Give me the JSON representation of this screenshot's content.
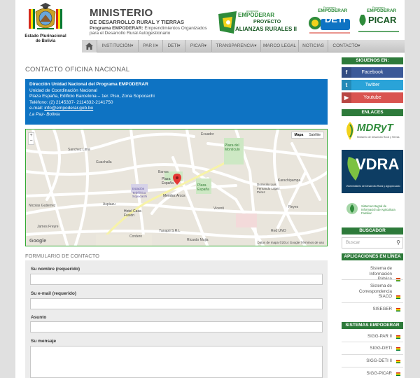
{
  "header": {
    "crest_text_1": "Estado Plurinacional",
    "crest_text_2": "de Bolivia",
    "ministry_title": "MINISTERIO",
    "ministry_subtitle": "DE DESARROLLO RURAL Y TIERRAS",
    "program_bold": "Programa EMPODERAR:",
    "program_desc_1": "Emprendimientos Organizados",
    "program_desc_2": "para el Desarrollo Rural Autogestionario",
    "logo_alianzas_small": "programa",
    "logo_alianzas_name": "EMPODERAR",
    "logo_alianzas_proj": "PROYECTO",
    "logo_alianzas_title": "ALIANZAS RURALES II",
    "logo_deti_small": "Programa",
    "logo_deti_top": "EMPODERAR",
    "logo_deti_name": "DETI",
    "logo_picar_small": "Programa",
    "logo_picar_top": "EMPODERAR",
    "logo_picar_name": "PICAR"
  },
  "nav": {
    "items": [
      {
        "label": "INSTITUCIÓN▾"
      },
      {
        "label": "PAR II▾"
      },
      {
        "label": "DETI▾"
      },
      {
        "label": "PICAR▾"
      },
      {
        "label": "TRANSPARENCIA▾"
      },
      {
        "label": "MARCO LEGAL"
      },
      {
        "label": "NOTICIAS"
      },
      {
        "label": "CONTACTO▾"
      }
    ]
  },
  "main": {
    "title": "CONTACTO OFICINA NACIONAL",
    "info": {
      "line1": "Dirección Unidad Nacional del Programa EMPODERAR",
      "line2": "Unidad de Coordinación Nacional",
      "line3": "Plaza España, Edificio Barcelona – 1er. Piso, Zona Sopocachi",
      "line4": "Teléfono: (2) 2145337- 2114332-2141750",
      "email_label": "e-mail:",
      "email": "info@empoderar.gob.bo",
      "city": "La Paz- Bolivia"
    },
    "map": {
      "zoom_in": "+",
      "zoom_out": "−",
      "type_map": "Mapa",
      "type_sat": "Satélite",
      "footer": "Datos de mapa ©2014 Google    Términos de uso",
      "brand": "Google",
      "labels": {
        "plaza_espana": "Plaza España",
        "plaza_espana2": "Plaza España",
        "plaza_montículo": "Plaza del Montículo",
        "mendez": "Mendez Arcos",
        "estacion": "Estación Teleférico Sopocachi",
        "hotel": "Hotel Casa Fusión",
        "domicilio": "Domicilio Luis Fernando López Pérez",
        "barros": "Barros",
        "vicenti": "Vicenti",
        "red_uno": "Red UNO",
        "yanapti": "Yanapti S.R.L",
        "ricardo": "Ricardo Mujia",
        "james": "James Freyre",
        "aspiazu": "Aspiazu",
        "cordero": "Cordero",
        "sanchez": "Sanchez Lima",
        "ecuador": "Ecuador",
        "guachalla": "Guachalla",
        "gutierrez": "Nicolas Gutierrez",
        "karachipampa": "Karachipampa",
        "reyes": "Reyes"
      }
    },
    "form_title": "FORMULARIO DE CONTACTO",
    "form": {
      "name_label": "Su nombre (requerido)",
      "email_label": "Su e-mail (requerido)",
      "subject_label": "Asunto",
      "message_label": "Su mensaje"
    }
  },
  "sidebar": {
    "follow_head": "SIGUENOS EN:",
    "facebook": "Facebook",
    "twitter": "Twitter",
    "youtube": "Youtube",
    "links_head": "ENLACES",
    "mdryt": "MDRyT",
    "mdryt_sub": "Ministerio de Desarrollo Rural y Tierras",
    "vdra_name": "VDRA",
    "vdra_sub": "Viceministerio de Desarrollo Rural y Agropecuario",
    "sis_name": "Sistema Integral de Información de Agricultura Familiar",
    "search_head": "BUSCADOR",
    "search_placeholder": "Buscar",
    "apps_head": "APLICACIONES EN LÍNEA",
    "apps": [
      {
        "label": "Sistema de Información Pública"
      },
      {
        "label": "Sistema de Correspondencia SIACO"
      },
      {
        "label": "SISEGER"
      }
    ],
    "systems_head": "SISTEMAS EMPODERAR",
    "systems": [
      {
        "label": "SIGG-PAR II"
      },
      {
        "label": "SIGG-DETI"
      },
      {
        "label": "SIGG-DETI II"
      },
      {
        "label": "SIGG-PICAR"
      }
    ]
  },
  "colors": {
    "accent_blue": "#0e73c3",
    "sidebar_green": "#2d7a3a",
    "facebook": "#3b5998",
    "twitter": "#2aa3d8",
    "youtube": "#d9534f"
  }
}
